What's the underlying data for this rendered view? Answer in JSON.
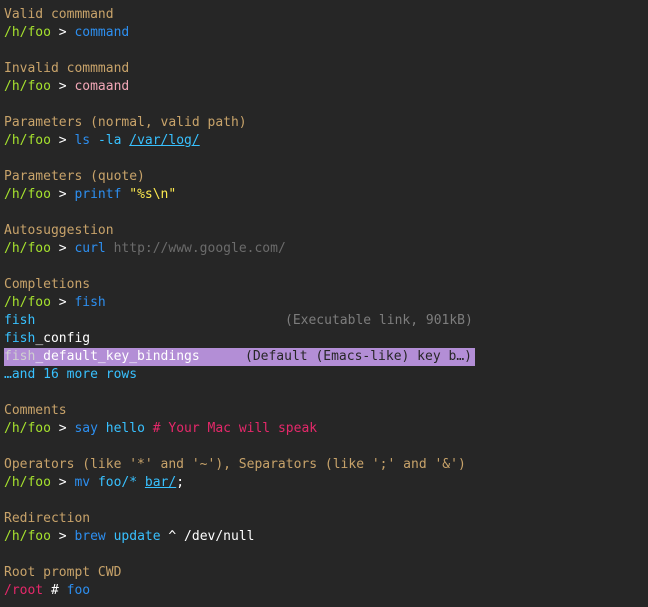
{
  "sections": {
    "valid": {
      "heading": "Valid commmand",
      "pwd": "/h/foo",
      "prompt_char": ">",
      "command": "command"
    },
    "invalid": {
      "heading": "Invalid commmand",
      "pwd": "/h/foo",
      "prompt_char": ">",
      "command": "comaand"
    },
    "params_path": {
      "heading": "Parameters (normal, valid path)",
      "pwd": "/h/foo",
      "prompt_char": ">",
      "command": "ls",
      "param": "-la",
      "path": "/var/log/"
    },
    "params_quote": {
      "heading": "Parameters (quote)",
      "pwd": "/h/foo",
      "prompt_char": ">",
      "command": "printf",
      "quote": "\"%s\\n\""
    },
    "autosuggest": {
      "heading": "Autosuggestion",
      "pwd": "/h/foo",
      "prompt_char": ">",
      "command": "curl",
      "suggestion": "http://www.google.com/"
    },
    "completions": {
      "heading": "Completions",
      "pwd": "/h/foo",
      "prompt_char": ">",
      "command": "fish",
      "items": [
        {
          "prefix": "fish",
          "rest": "",
          "desc": "(Executable link, 901kB)"
        },
        {
          "prefix": "fish",
          "rest": "_config",
          "desc": ""
        },
        {
          "prefix": "fish",
          "rest": "_default_key_bindings",
          "desc": "(Default (Emacs-like) key b…)"
        }
      ],
      "more": "…and 16 more rows"
    },
    "comments": {
      "heading": "Comments",
      "pwd": "/h/foo",
      "prompt_char": ">",
      "command": "say",
      "param": "hello",
      "comment": "# Your Mac will speak"
    },
    "operators": {
      "heading": "Operators (like '*' and '~'), Separators (like ';' and '&')",
      "pwd": "/h/foo",
      "prompt_char": ">",
      "command": "mv",
      "param": "foo/*",
      "path": "bar/",
      "separator": ";"
    },
    "redirection": {
      "heading": "Redirection",
      "pwd": "/h/foo",
      "prompt_char": ">",
      "command": "brew",
      "param": "update",
      "redirect": "^ /dev/null"
    },
    "root": {
      "heading": "Root prompt CWD",
      "pwd": "/root",
      "prompt_char": "#",
      "command": "foo"
    }
  },
  "colors": {
    "background": "#262626",
    "heading": "#c8a36a",
    "pwd": "#a6e22e",
    "command": "#2d8ff0",
    "error": "#f2a7b7",
    "param": "#38c1ff",
    "quote": "#fce94f",
    "comment": "#e5286a",
    "selection": "#b38ed6"
  }
}
